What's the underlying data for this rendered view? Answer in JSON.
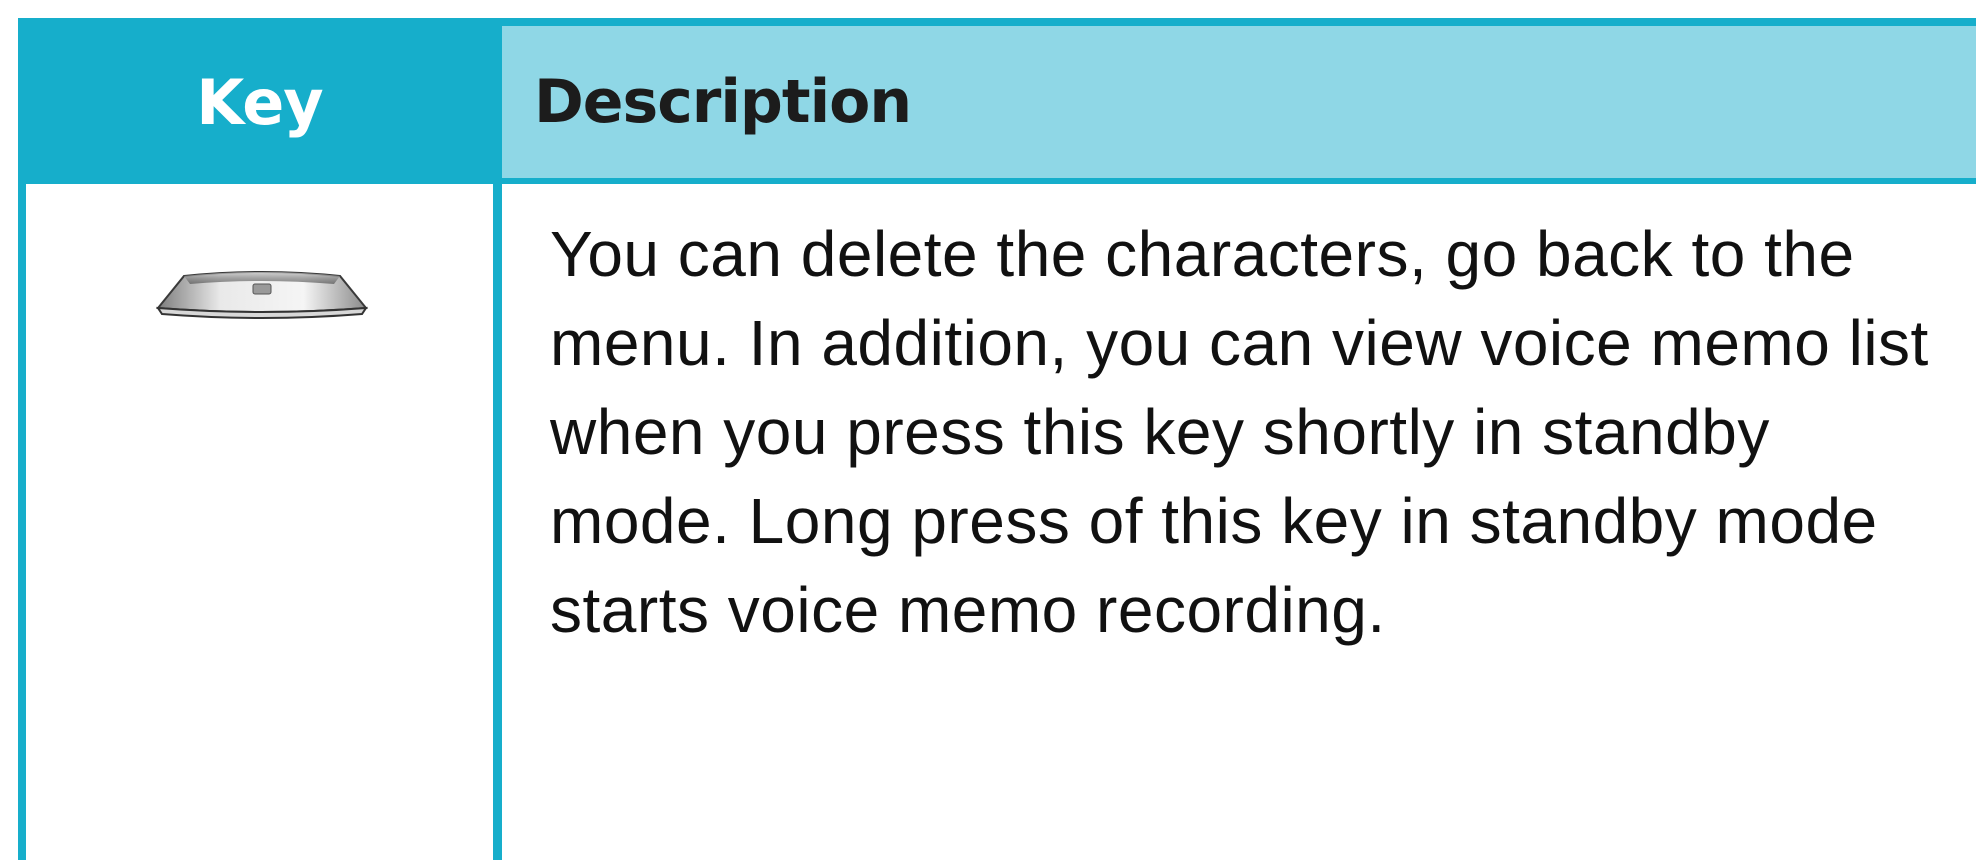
{
  "table": {
    "header": {
      "key_label": "Key",
      "description_label": "Description"
    },
    "rows": [
      {
        "key_icon": "clear-key-icon",
        "description": "You can delete the characters, go back to the menu. In addition, you can view voice memo list when you press this key shortly in standby mode. Long press of this key in standby mode starts voice memo recording."
      }
    ]
  },
  "colors": {
    "header_key_bg": "#16aecb",
    "header_description_bg": "#8fd7e6",
    "border": "#16aecb",
    "text": "#111111"
  }
}
